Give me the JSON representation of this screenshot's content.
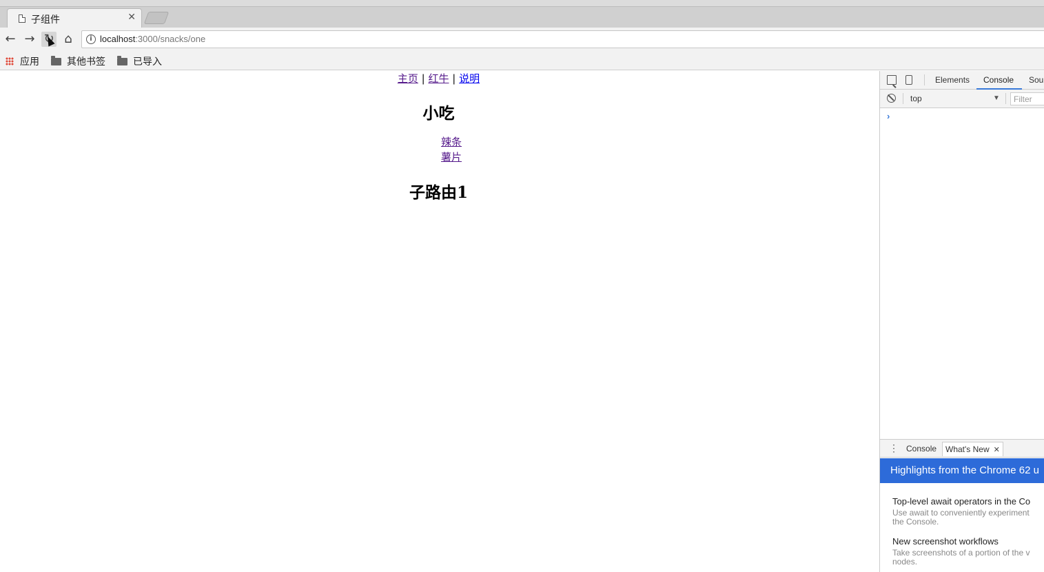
{
  "browser": {
    "tab": {
      "title": "子组件",
      "close_glyph": "✕"
    },
    "toolbar": {
      "back_glyph": "←",
      "forward_glyph": "→",
      "reload_glyph": "↻",
      "home_glyph": "⌂",
      "url_host": "localhost",
      "url_path": ":3000/snacks/one",
      "info_glyph": "i"
    },
    "bookmarks": [
      {
        "label": "应用",
        "icon": "apps-grid-icon"
      },
      {
        "label": "其他书签",
        "icon": "folder-icon"
      },
      {
        "label": "已导入",
        "icon": "folder-icon"
      }
    ]
  },
  "page": {
    "nav": {
      "home": "主页",
      "redbull": "红牛",
      "about": "说明",
      "separator": "|"
    },
    "title": "小吃",
    "snacks": [
      "辣条",
      "薯片"
    ],
    "route_title": "子路由1"
  },
  "devtools": {
    "tabs": {
      "elements": "Elements",
      "console": "Console",
      "sources": "Sou"
    },
    "context": "top",
    "context_arrow": "▼",
    "filter_placeholder": "Filter",
    "prompt": "›",
    "drawer": {
      "menu_glyph": "⋮",
      "console_tab": "Console",
      "whatsnew_tab": "What's New",
      "close_glyph": "✕"
    },
    "whatsnew": {
      "banner": "Highlights from the Chrome 62 u",
      "items": [
        {
          "title": "Top-level await operators in the Co",
          "desc1": "Use await to conveniently experiment",
          "desc2": "the Console."
        },
        {
          "title": "New screenshot workflows",
          "desc1": "Take screenshots of a portion of the v",
          "desc2": "nodes."
        }
      ]
    }
  },
  "colors": {
    "visited_link": "#551a8b",
    "unvisited_link": "#0000ee",
    "devtools_accent": "#3879d9",
    "banner_blue": "#2d6bd9"
  }
}
